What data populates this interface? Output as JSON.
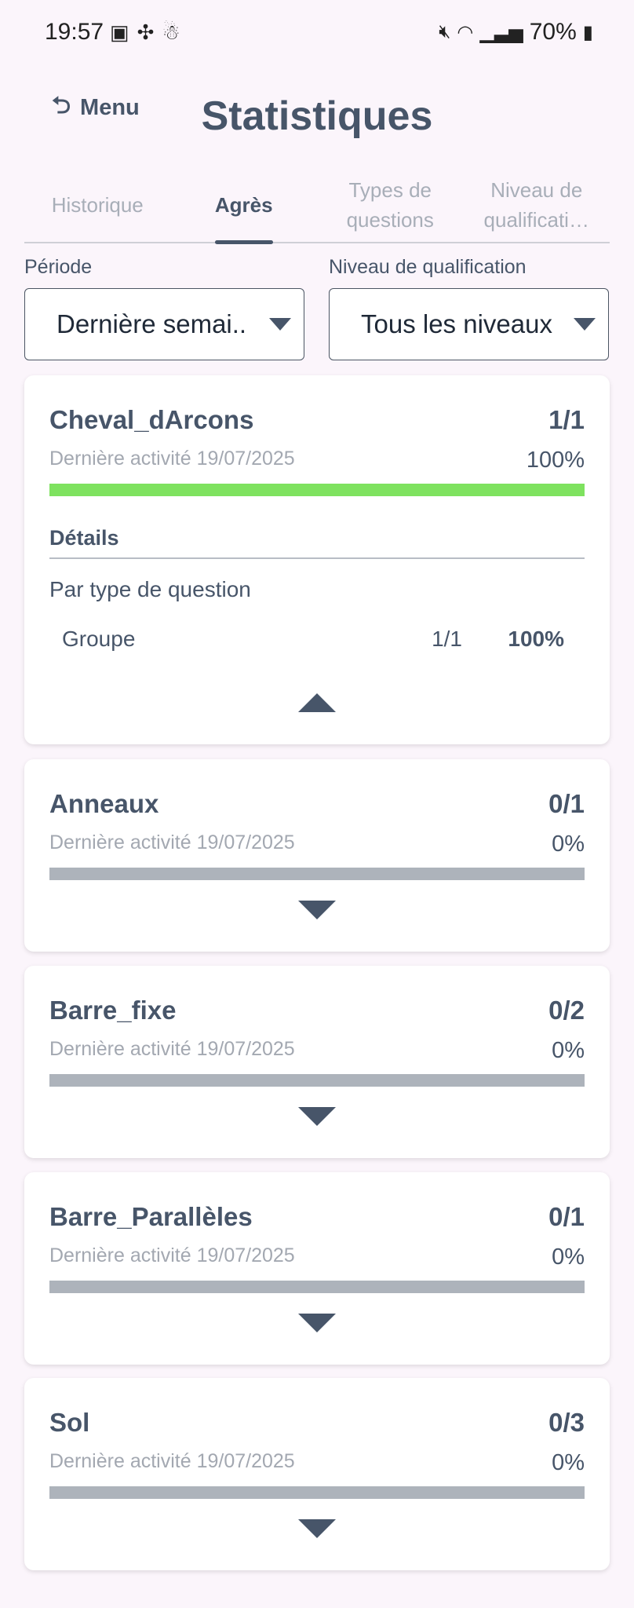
{
  "status_bar": {
    "time": "19:57",
    "left_icons": [
      "image-icon",
      "pinwheel-icon",
      "snowman-icon"
    ],
    "right_icons": [
      "mute-icon",
      "wifi-icon",
      "signal-icon",
      "battery-icon"
    ],
    "battery": "70%"
  },
  "header": {
    "back_label": "Menu",
    "title": "Statistiques"
  },
  "tabs": [
    {
      "label": "Historique",
      "active": false
    },
    {
      "label": "Agrès",
      "active": true
    },
    {
      "label": "Types de questions",
      "active": false
    },
    {
      "label": "Niveau de qualificati…",
      "active": false
    }
  ],
  "filters": {
    "period_label": "Période",
    "period_value": "Dernière semai..",
    "level_label": "Niveau de qualification",
    "level_value": "Tous les niveaux"
  },
  "colors": {
    "accent": "#475569",
    "progress_complete": "#7ee25f",
    "progress_empty": "#adb3bb"
  },
  "cards": [
    {
      "name": "Cheval_dArcons",
      "score": "1/1",
      "date": "Dernière activité 19/07/2025",
      "percent": "100%",
      "progress": 1.0,
      "expanded": true,
      "details": {
        "title": "Détails",
        "subtitle": "Par type de question",
        "rows": [
          {
            "name": "Groupe",
            "score": "1/1",
            "percent": "100%"
          }
        ]
      }
    },
    {
      "name": "Anneaux",
      "score": "0/1",
      "date": "Dernière activité 19/07/2025",
      "percent": "0%",
      "progress": 0,
      "expanded": false
    },
    {
      "name": "Barre_fixe",
      "score": "0/2",
      "date": "Dernière activité 19/07/2025",
      "percent": "0%",
      "progress": 0,
      "expanded": false
    },
    {
      "name": "Barre_Parallèles",
      "score": "0/1",
      "date": "Dernière activité 19/07/2025",
      "percent": "0%",
      "progress": 0,
      "expanded": false
    },
    {
      "name": "Sol",
      "score": "0/3",
      "date": "Dernière activité 19/07/2025",
      "percent": "0%",
      "progress": 0,
      "expanded": false
    }
  ]
}
